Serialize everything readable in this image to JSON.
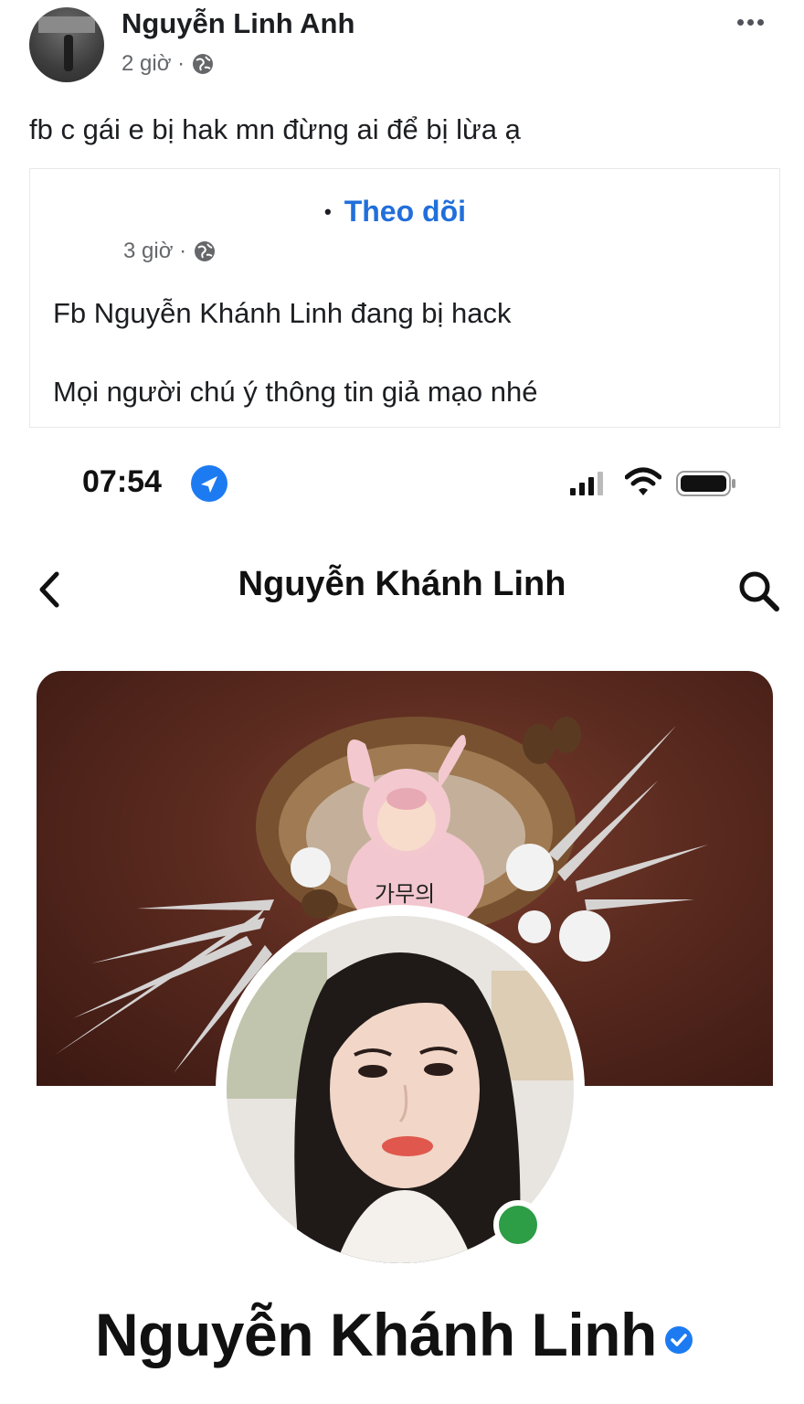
{
  "post": {
    "author": "Nguyễn Linh Anh",
    "time": "2 giờ ·",
    "text": "fb c gái e bị hak mn đừng ai để bị lừa ạ"
  },
  "shared_post": {
    "follow_label": "Theo dõi",
    "time": "3 giờ ·",
    "line1": "Fb Nguyễn Khánh Linh đang bị hack",
    "line2": "Mọi người chú ý thông tin giả mạo nhé"
  },
  "screenshot": {
    "clock": "07:54",
    "nav_title": "Nguyễn Khánh Linh",
    "profile_name": "Nguyễn Khánh Linh",
    "cover_text": "가무의"
  },
  "colors": {
    "link_blue": "#216fdb",
    "online_green": "#2d9d46",
    "verified_blue": "#1d7bf2"
  }
}
